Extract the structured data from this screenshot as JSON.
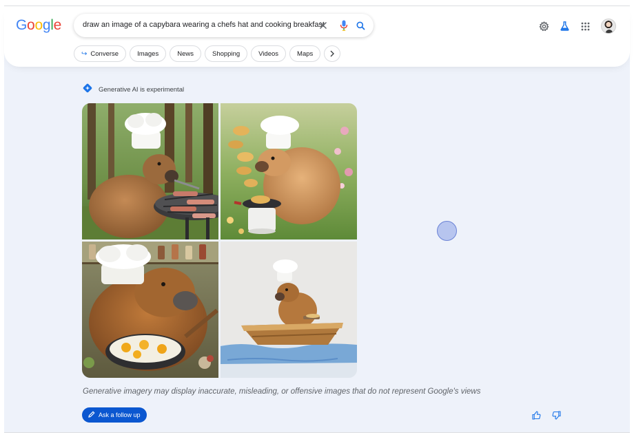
{
  "brand": {
    "logo_text": "Google",
    "colors": [
      "#4285F4",
      "#EA4335",
      "#FBBC05",
      "#4285F4",
      "#34A853",
      "#EA4335"
    ]
  },
  "search": {
    "query": "draw an image of a capybara wearing a chefs hat and cooking breakfast",
    "icons": [
      "clear-icon",
      "microphone-icon",
      "search-icon"
    ]
  },
  "header_icons": [
    "gear-icon",
    "labs-flask-icon",
    "apps-grid-icon",
    "account-avatar"
  ],
  "chips": [
    {
      "label": "Converse",
      "icon": "follow-up-arrow-icon"
    },
    {
      "label": "Images"
    },
    {
      "label": "News"
    },
    {
      "label": "Shopping"
    },
    {
      "label": "Videos"
    },
    {
      "label": "Maps"
    }
  ],
  "more_chips_icon": "chevron-right-icon",
  "ai": {
    "label": "Generative AI is experimental",
    "images": [
      "capybara-chef-grilling-bacon-forest",
      "capybara-chef-flipping-pancakes-garden",
      "capybara-chef-frying-eggs-kitchen",
      "capybara-chef-in-boat-cooking"
    ],
    "disclaimer": "Generative imagery may display inaccurate, misleading, or offensive images that do not represent Google's views",
    "follow_up_label": "Ask a follow up"
  },
  "feedback_icons": [
    "thumbs-up-icon",
    "thumbs-down-icon"
  ],
  "accent_color": "#0b57d0"
}
